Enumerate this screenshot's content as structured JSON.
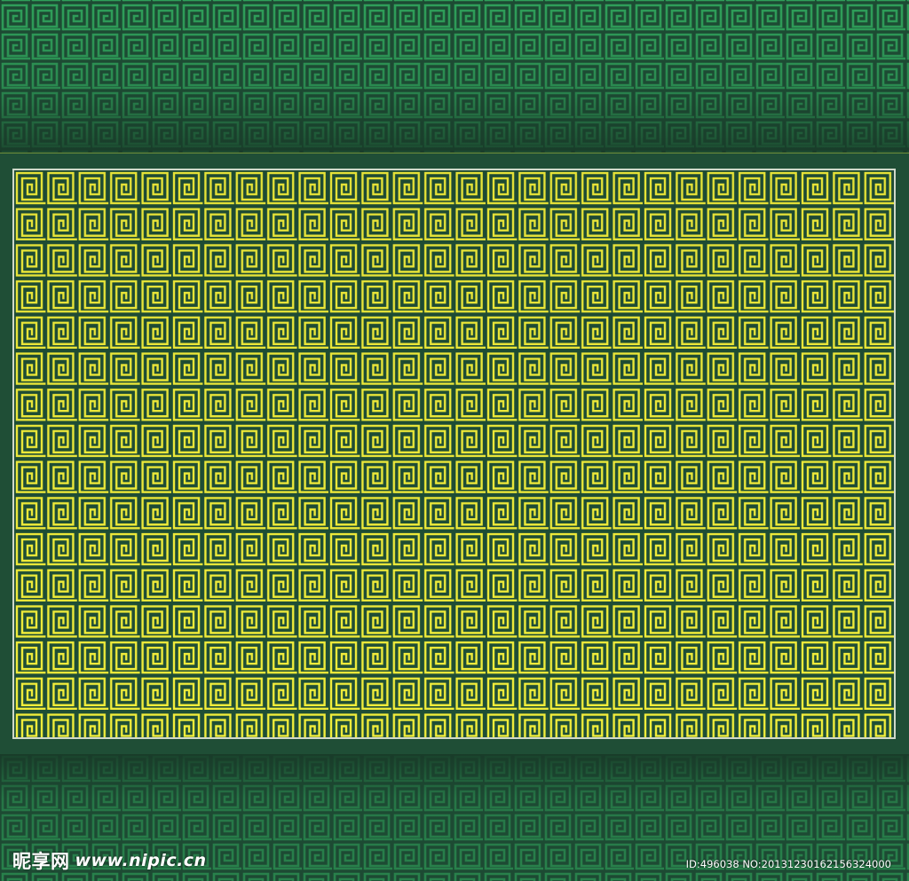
{
  "pattern": {
    "name": "greek-key-fret",
    "panel_color": "#1f4e36",
    "band_color": "#1d4a33",
    "motif_color_panel": "#f2ee3a",
    "motif_color_band": "#2fa05a",
    "frame_color": "#cfd8c9"
  },
  "watermark": {
    "brand": "昵享网",
    "url": "www.nipic.cn"
  },
  "image_id": "ID:496038 NO:20131230162156324000"
}
